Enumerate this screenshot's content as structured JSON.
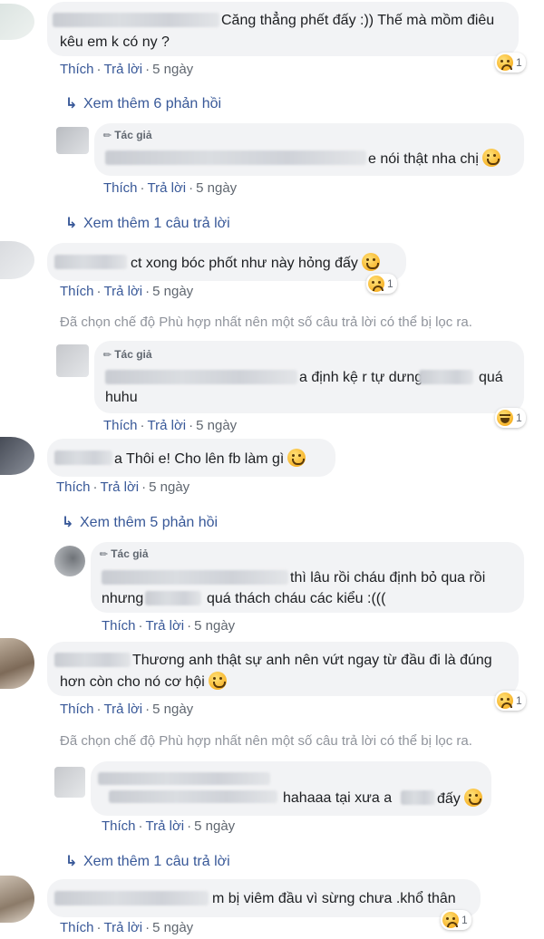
{
  "labels": {
    "like": "Thích",
    "reply": "Trả lời",
    "author_badge": "Tác giả",
    "filter_notice": "Đã chọn chế độ Phù hợp nhất nên một số câu trả lời có thể bị lọc ra."
  },
  "comments": [
    {
      "text_line1": "Căng thẳng phết đấy :)) Thế mà mồm điêu",
      "text_line2": "kêu em k có ny ?",
      "time": "5 ngày",
      "reaction_count": "1"
    },
    {
      "more": "Xem thêm 6 phản hồi"
    },
    {
      "text": "e nói thật nha chị",
      "time": "5 ngày"
    },
    {
      "more": "Xem thêm 1 câu trả lời"
    },
    {
      "text": "ct xong bóc phốt như này hỏng đấy",
      "time": "5 ngày",
      "reaction_count": "1"
    },
    {
      "text_line1": "a định kệ r tự dưng",
      "text_line1b": "quá",
      "text_line2": "huhu",
      "time": "5 ngày",
      "reaction_count": "1"
    },
    {
      "text": "a Thôi e! Cho lên fb làm gì",
      "time": "5 ngày"
    },
    {
      "more": "Xem thêm 5 phản hồi"
    },
    {
      "text_line1": "thì lâu rồi cháu định bỏ qua rồi",
      "text_line2a": "nhưng",
      "text_line2b": "quá thách cháu các kiểu :(((",
      "time": "5 ngày"
    },
    {
      "text_line1": "Thương anh thật sự anh nên vứt ngay từ đầu đi là đúng",
      "text_line2": "hơn còn cho nó cơ hội",
      "time": "5 ngày",
      "reaction_count": "1"
    },
    {
      "text_a": "hahaaa tại xưa a",
      "text_b": "đấy",
      "time": "5 ngày"
    },
    {
      "more": "Xem thêm 1 câu trả lời"
    },
    {
      "text": "m bị viêm đầu vì sừng chưa .khổ thân",
      "time": "5 ngày",
      "reaction_count": "1"
    }
  ],
  "colors": {
    "link": "#385898",
    "bubble": "#f2f3f5",
    "muted": "#90949c"
  }
}
